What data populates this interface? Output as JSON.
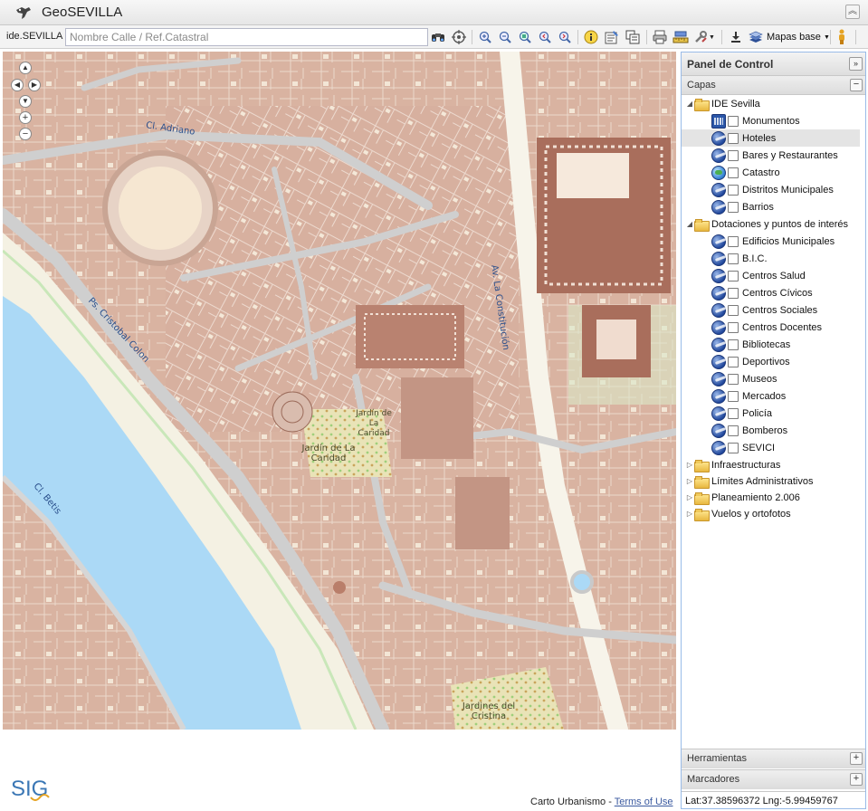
{
  "app": {
    "title": "GeoSEVILLA"
  },
  "toolbar": {
    "ide_label": "ide.SEVILLA",
    "search_placeholder": "Nombre Calle / Ref.Catastral",
    "mapas_base_label": "Mapas base"
  },
  "map": {
    "streets": [
      "Cl. Adriano",
      "Av. La Constitución",
      "Ps. Cristobal Colon",
      "Cl. Betis"
    ],
    "parks": [
      "Jardín de La Caridad",
      "Jardín de La Caridad",
      "Jardines del Cristina"
    ],
    "attribution_text": "Carto Urbanismo - ",
    "attribution_link": "Terms of Use"
  },
  "panel": {
    "title": "Panel de Control",
    "capas_label": "Capas",
    "tree": [
      {
        "label": "IDE Sevilla",
        "type": "folder",
        "expanded": true
      },
      {
        "label": "Monumentos",
        "type": "layer",
        "icon": "monument-icon"
      },
      {
        "label": "Hoteles",
        "type": "layer",
        "icon": "layer-icon",
        "selected": true
      },
      {
        "label": "Bares y Restaurantes",
        "type": "layer",
        "icon": "layer-icon"
      },
      {
        "label": "Catastro",
        "type": "layer",
        "icon": "globe-icon"
      },
      {
        "label": "Distritos Municipales",
        "type": "layer",
        "icon": "layer-icon"
      },
      {
        "label": "Barrios",
        "type": "layer",
        "icon": "layer-icon"
      },
      {
        "label": "Dotaciones y puntos de interés",
        "type": "folder",
        "expanded": true
      },
      {
        "label": "Edificios Municipales",
        "type": "layer",
        "icon": "layer-icon"
      },
      {
        "label": "B.I.C.",
        "type": "layer",
        "icon": "layer-icon"
      },
      {
        "label": "Centros Salud",
        "type": "layer",
        "icon": "layer-icon"
      },
      {
        "label": "Centros Cívicos",
        "type": "layer",
        "icon": "layer-icon"
      },
      {
        "label": "Centros Sociales",
        "type": "layer",
        "icon": "layer-icon"
      },
      {
        "label": "Centros Docentes",
        "type": "layer",
        "icon": "layer-icon"
      },
      {
        "label": "Bibliotecas",
        "type": "layer",
        "icon": "layer-icon"
      },
      {
        "label": "Deportivos",
        "type": "layer",
        "icon": "layer-icon"
      },
      {
        "label": "Museos",
        "type": "layer",
        "icon": "layer-icon"
      },
      {
        "label": "Mercados",
        "type": "layer",
        "icon": "layer-icon"
      },
      {
        "label": "Policía",
        "type": "layer",
        "icon": "layer-icon"
      },
      {
        "label": "Bomberos",
        "type": "layer",
        "icon": "layer-icon"
      },
      {
        "label": "SEVICI",
        "type": "layer",
        "icon": "layer-icon"
      },
      {
        "label": "Infraestructuras",
        "type": "folder",
        "expanded": false
      },
      {
        "label": "Límites Administrativos",
        "type": "folder",
        "expanded": false
      },
      {
        "label": "Planeamiento 2.006",
        "type": "folder",
        "expanded": false
      },
      {
        "label": "Vuelos y ortofotos",
        "type": "folder",
        "expanded": false
      }
    ],
    "herramientas_label": "Herramientas",
    "marcadores_label": "Marcadores",
    "coords_text": "Lat:37.38596372 Lng:-5.99459767"
  },
  "logo": {
    "text": "SIG"
  }
}
